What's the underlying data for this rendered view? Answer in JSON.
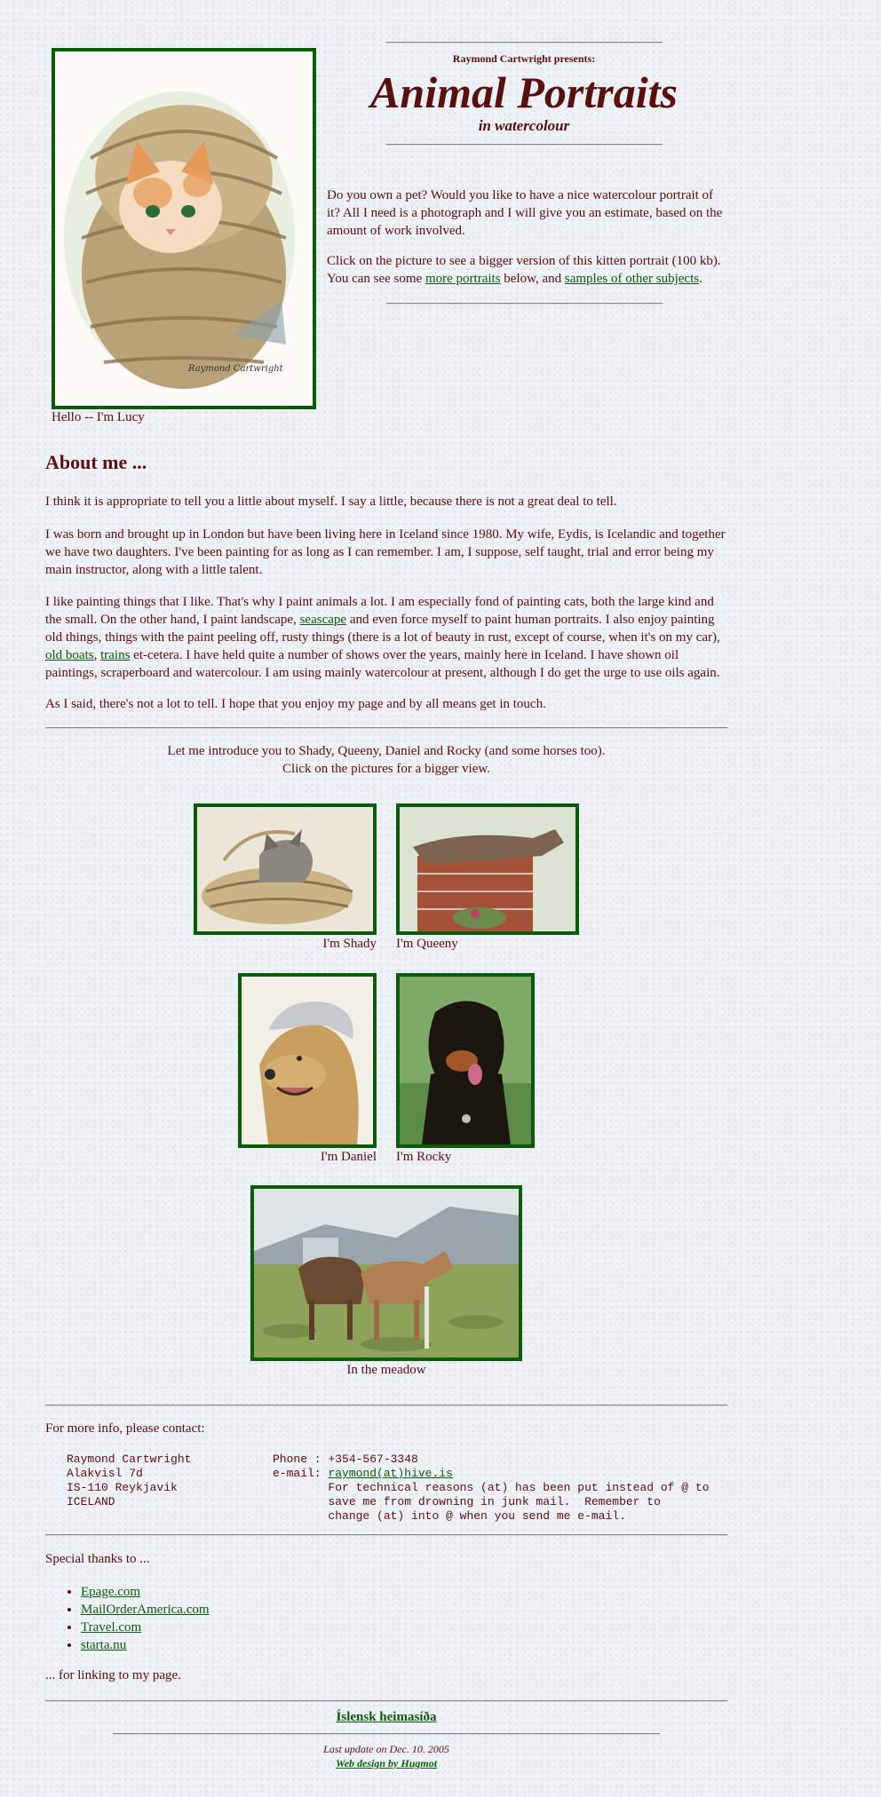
{
  "header": {
    "presenter": "Raymond Cartwright presents:",
    "title": "Animal Portraits",
    "subtitle": "in watercolour"
  },
  "hero": {
    "caption": "Hello -- I'm Lucy"
  },
  "intro": {
    "p1": "Do you own a pet? Would you like to have a nice watercolour portrait of it? All I need is a photograph and I will give you an estimate, based on the amount of work involved.",
    "p2_start": "Click on the picture to see a bigger version of this kitten portrait (100 kb). You can see some ",
    "link_more": "more portraits",
    "p2_mid": " below, and ",
    "link_samples": "samples of other subjects",
    "p2_end": "."
  },
  "about": {
    "heading": "About me ...",
    "p1": "I think it is appropriate to tell you a little about myself. I say a little, because there is not a great deal to tell.",
    "p2": "I was born and brought up in London but have been living here in Iceland since 1980. My wife, Eydis, is Icelandic and together we have two daughters. I've been painting for as long as I can remember. I am, I suppose, self taught, trial and error being my main instructor, along with a little talent.",
    "p3_a": "I like painting things that I like. That's why I paint animals a lot. I am especially fond of painting cats, both the large kind and the small. On the other hand, I paint landscape, ",
    "link_seascape": "seascape",
    "p3_b": " and even force myself to paint human portraits. I also enjoy painting old things, things with the paint peeling off, rusty things (there is a lot of beauty in rust, except of course, when it's on my car), ",
    "link_boats": "old boats",
    "p3_c": ", ",
    "link_trains": "trains",
    "p3_d": " et-cetera. I have held quite a number of shows over the years, mainly here in Iceland. I have shown oil paintings, scraperboard and watercolour. I am using mainly watercolour at present, although I do get the urge to use oils again.",
    "p4": "As I said, there's not a lot to tell. I hope that you enjoy my page and by all means get in touch."
  },
  "gallery": {
    "intro1": "Let me introduce you to Shady, Queeny, Daniel and Rocky (and some horses too).",
    "intro2": "Click on the pictures for a bigger view.",
    "shady": "I'm Shady",
    "queeny": "I'm Queeny",
    "daniel": "I'm Daniel",
    "rocky": "I'm Rocky",
    "meadow": "In the meadow"
  },
  "contact": {
    "heading": "For more info, please contact:",
    "name": "Raymond Cartwright",
    "street": "Alakvisl 7d",
    "city": "IS-110 Reykjavik",
    "country": "ICELAND",
    "phone_label": "Phone : ",
    "phone": "+354-567-3348",
    "email_label": "e-mail: ",
    "email": "raymond(at)hive.is",
    "note1": "For technical reasons (at) has been put instead of @ to",
    "note2": "save me from drowning in junk mail.  Remember to",
    "note3": "change (at) into @ when you send me e-mail."
  },
  "thanks": {
    "heading": "Special thanks to ...",
    "links": [
      "Epage.com",
      "MailOrderAmerica.com",
      "Travel.com",
      "starta.nu"
    ],
    "footer": "... for linking to my page."
  },
  "footer": {
    "icelandic": "Íslensk heimasíða",
    "updated": "Last update on Dec. 10. 2005",
    "design": "Web design by Hugmot"
  },
  "colors": {
    "text": "#5a0f0f",
    "link": "#0d5a0d",
    "frame": "#0d5a0d"
  }
}
